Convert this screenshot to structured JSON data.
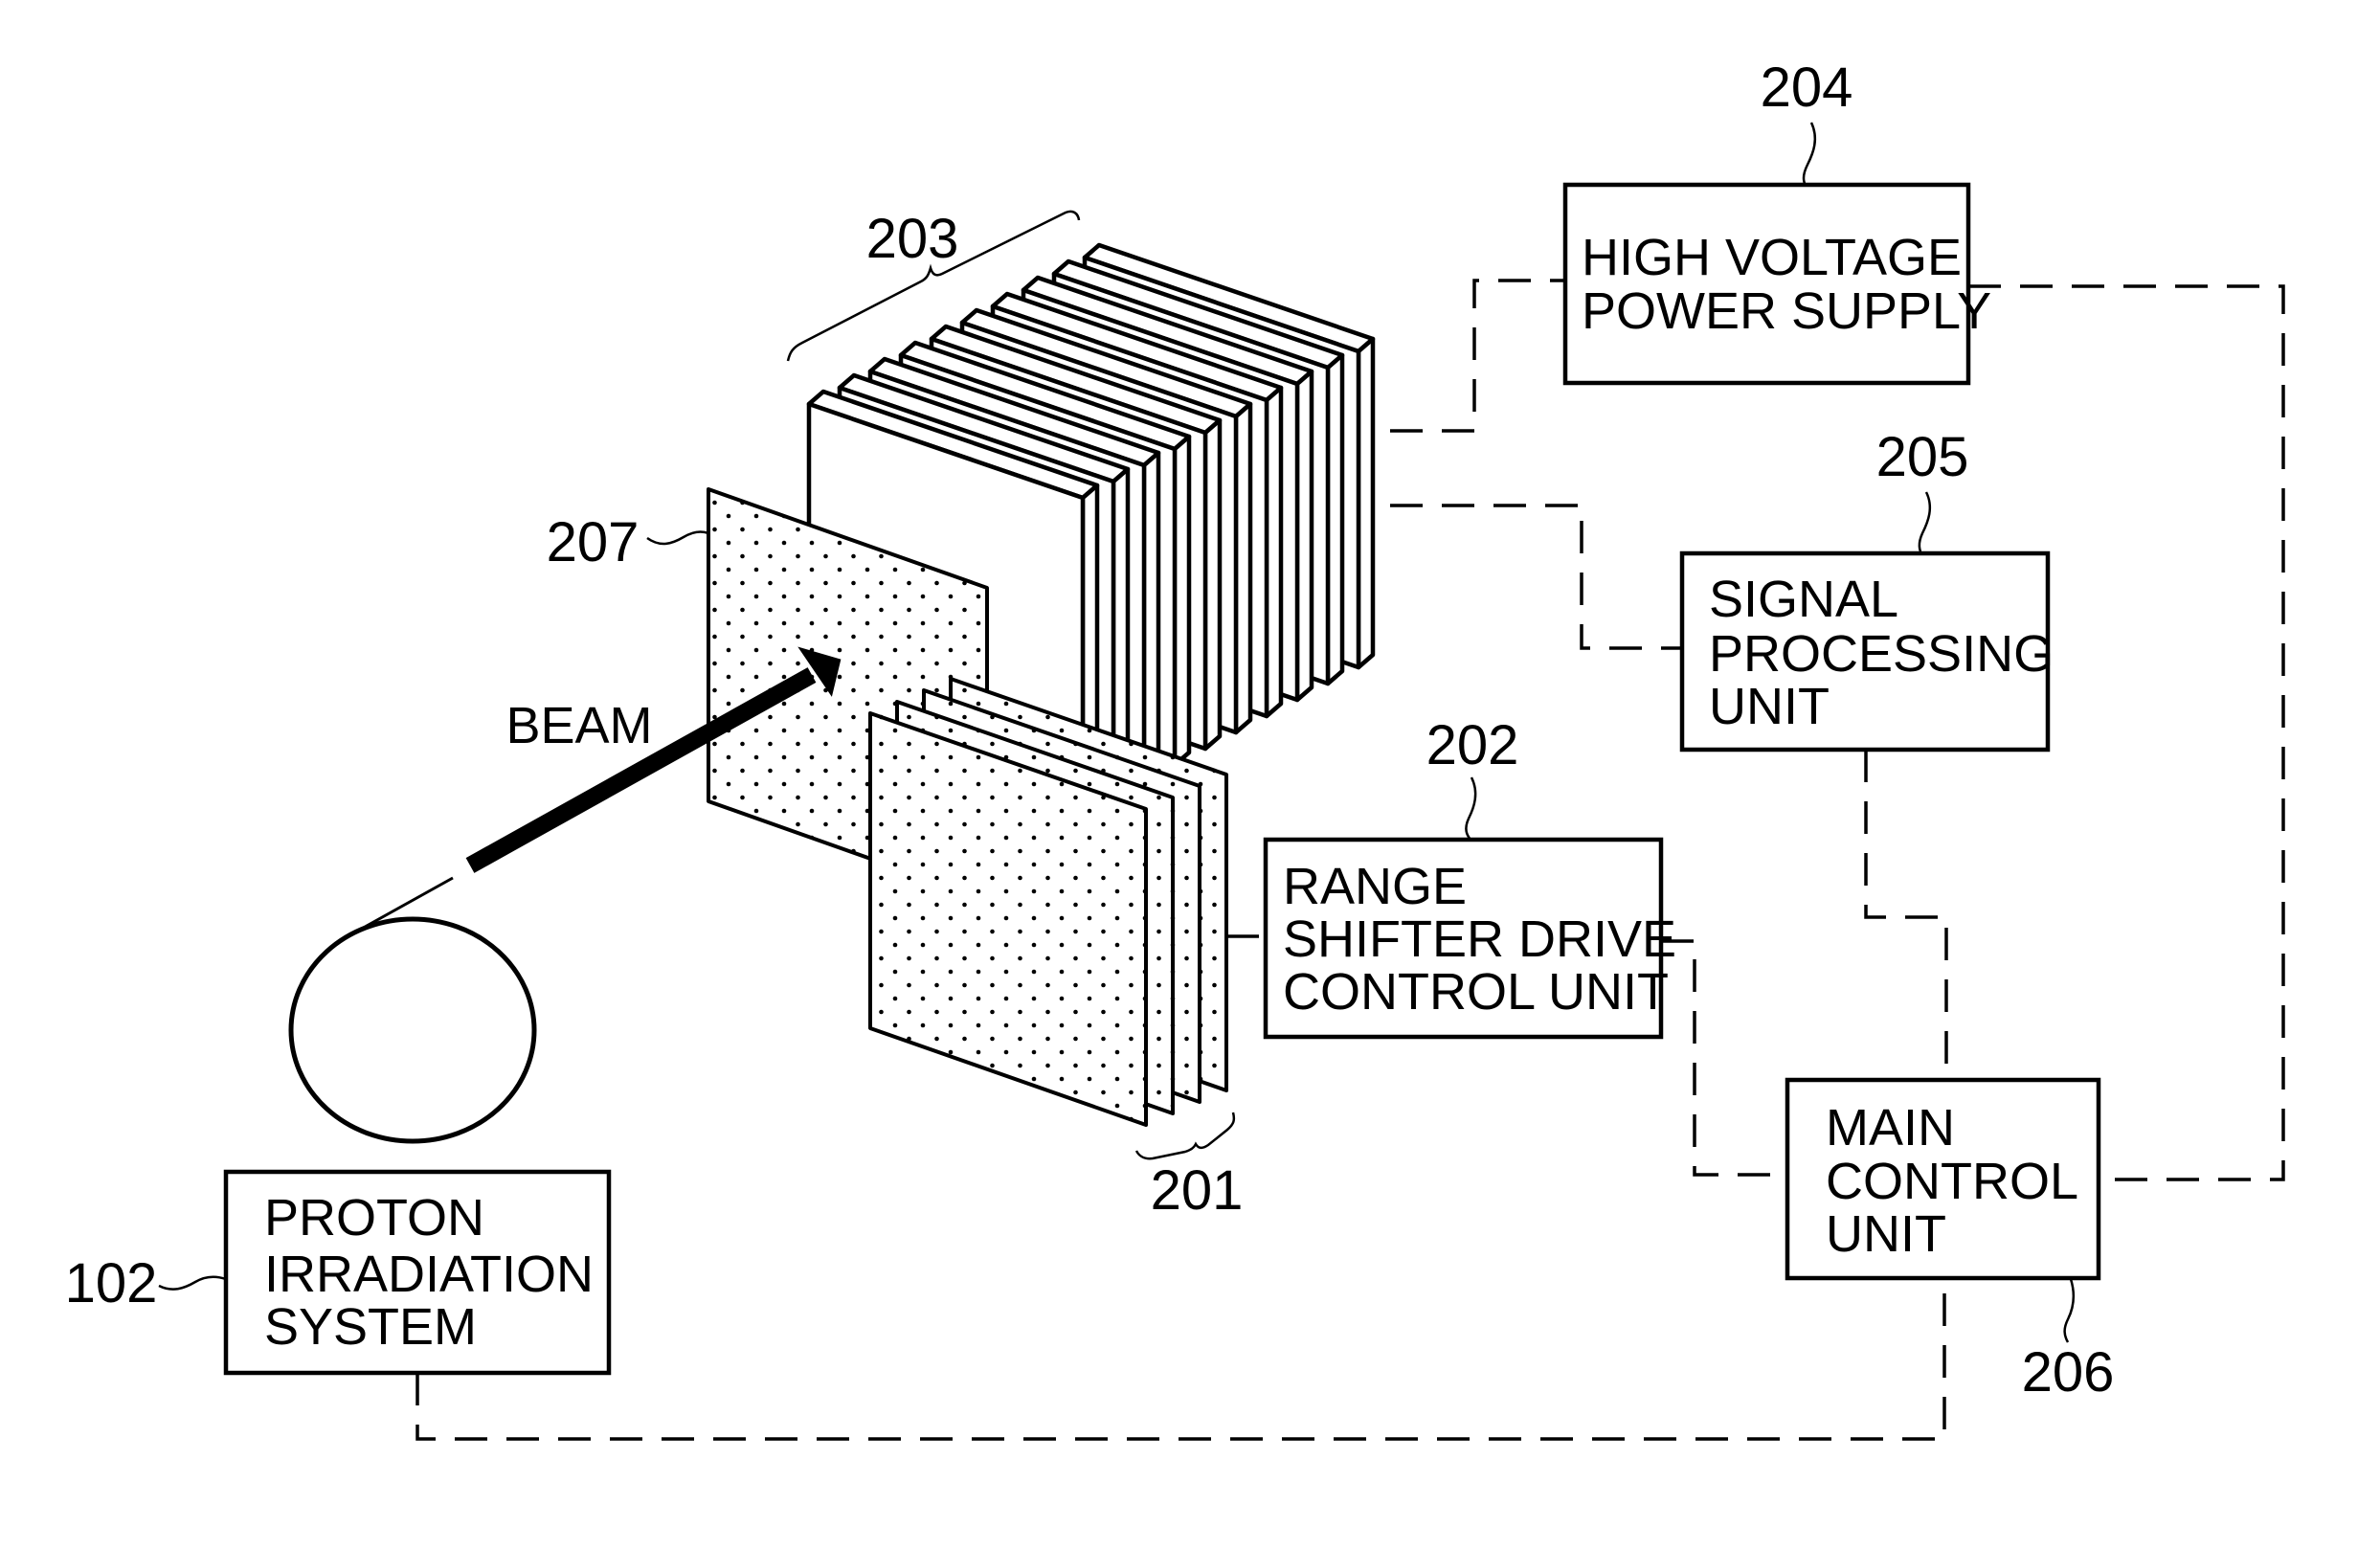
{
  "figure": {
    "beam_label": "BEAM",
    "detector_plate_count": 10,
    "range_shifter_plate_count": 4
  },
  "reference_numerals": {
    "proton_irradiation_system": "102",
    "range_shifter": "201",
    "range_shifter_drive_control_unit": "202",
    "detector_stack": "203",
    "high_voltage_power_supply": "204",
    "signal_processing_unit": "205",
    "main_control_unit": "206",
    "dose_plate": "207"
  },
  "blocks": {
    "high_voltage_power_supply": {
      "lines": [
        "HIGH VOLTAGE",
        "POWER SUPPLY"
      ]
    },
    "signal_processing_unit": {
      "lines": [
        "SIGNAL",
        "PROCESSING",
        "UNIT"
      ]
    },
    "range_shifter_drive_control_unit": {
      "lines": [
        "RANGE",
        "SHIFTER DRIVE",
        "CONTROL UNIT"
      ]
    },
    "main_control_unit": {
      "lines": [
        "MAIN",
        "CONTROL",
        "UNIT"
      ]
    },
    "proton_irradiation_system": {
      "lines": [
        "PROTON",
        "IRRADIATION",
        "SYSTEM"
      ]
    }
  },
  "connections": [
    {
      "from": "detector_stack",
      "to": "high_voltage_power_supply",
      "style": "dashed"
    },
    {
      "from": "detector_stack",
      "to": "signal_processing_unit",
      "style": "dashed"
    },
    {
      "from": "signal_processing_unit",
      "to": "main_control_unit",
      "style": "dashed"
    },
    {
      "from": "range_shifter",
      "to": "range_shifter_drive_control_unit",
      "style": "dashed"
    },
    {
      "from": "range_shifter_drive_control_unit",
      "to": "main_control_unit",
      "style": "dashed"
    },
    {
      "from": "high_voltage_power_supply",
      "to": "main_control_unit",
      "style": "dashed"
    },
    {
      "from": "proton_irradiation_system",
      "to": "main_control_unit",
      "style": "dashed"
    }
  ]
}
